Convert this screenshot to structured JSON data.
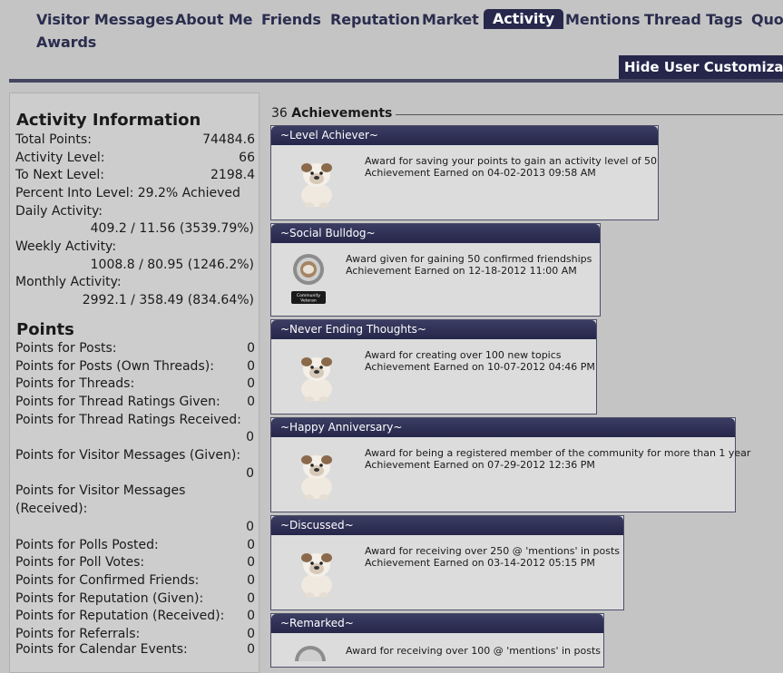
{
  "tabs": [
    {
      "label": "Visitor Messages"
    },
    {
      "label": "About Me"
    },
    {
      "label": "Friends"
    },
    {
      "label": "Reputation"
    },
    {
      "label": "Market"
    },
    {
      "label": "Activity"
    },
    {
      "label": "Mentions"
    },
    {
      "label": "Thread Tags"
    },
    {
      "label": "Quot"
    },
    {
      "label": "Awards"
    }
  ],
  "active_tab": "Activity",
  "hide_button": "Hide User Customizat",
  "activity": {
    "title": "Activity Information",
    "total_points_label": "Total Points:",
    "total_points": "74484.6",
    "activity_level_label": "Activity Level:",
    "activity_level": "66",
    "next_level_label": "To Next Level:",
    "next_level": "2198.4",
    "percent_text": "Percent Into Level: 29.2% Achieved",
    "daily_label": "Daily Activity:",
    "daily": "409.2 / 11.56 (3539.79%)",
    "weekly_label": "Weekly Activity:",
    "weekly": "1008.8 / 80.95 (1246.2%)",
    "monthly_label": "Monthly Activity:",
    "monthly": "2992.1 / 358.49 (834.64%)"
  },
  "points": {
    "title": "Points",
    "rows": [
      {
        "label": "Points for Posts:",
        "value": "0"
      },
      {
        "label": "Points for Posts (Own Threads):",
        "value": "0"
      },
      {
        "label": "Points for Threads:",
        "value": "0"
      },
      {
        "label": "Points for Thread Ratings Given:",
        "value": "0"
      },
      {
        "label": "Points for Thread Ratings Received:",
        "value": "0"
      },
      {
        "label": "Points for Visitor Messages (Given):",
        "value": "0"
      },
      {
        "label": "Points for Visitor Messages",
        "label2": "(Received):",
        "value": "0"
      },
      {
        "label": "Points for Polls Posted:",
        "value": "0"
      },
      {
        "label": "Points for Poll Votes:",
        "value": "0"
      },
      {
        "label": "Points for Confirmed Friends:",
        "value": "0"
      },
      {
        "label": "Points for Reputation (Given):",
        "value": "0"
      },
      {
        "label": "Points for Reputation (Received):",
        "value": "0"
      },
      {
        "label": "Points for Referrals:",
        "value": "0"
      },
      {
        "label": "Points for Calendar Events:",
        "value": "0"
      }
    ]
  },
  "achievements": {
    "count": "36",
    "label": "Achievements",
    "items": [
      {
        "title": "~Level Achiever~",
        "desc": "Award for saving your points to gain an activity level of 50",
        "earned": "Achievement Earned on 04-02-2013 09:58 AM",
        "icon": "bulldog-icon"
      },
      {
        "title": "~Social Bulldog~",
        "desc": "Award given for gaining 50 confirmed friendships",
        "earned": "Achievement Earned on 12-18-2012 11:00 AM",
        "icon": "community-veteran-trophy-icon",
        "badge_text": "Community Veteran"
      },
      {
        "title": "~Never Ending Thoughts~",
        "desc": "Award for creating over 100 new topics",
        "earned": "Achievement Earned on 10-07-2012 04:46 PM",
        "icon": "bulldog-icon"
      },
      {
        "title": "~Happy Anniversary~",
        "desc": "Award for being a registered member of the community for more than 1 year",
        "earned": "Achievement Earned on 07-29-2012 12:36 PM",
        "icon": "bulldog-icon"
      },
      {
        "title": "~Discussed~",
        "desc": "Award for receiving over 250 @ 'mentions' in posts",
        "earned": "Achievement Earned on 03-14-2012 05:15 PM",
        "icon": "bulldog-icon"
      },
      {
        "title": "~Remarked~",
        "desc": "Award for receiving over 100 @ 'mentions' in posts",
        "earned": "",
        "icon": "trophy-icon"
      }
    ]
  }
}
